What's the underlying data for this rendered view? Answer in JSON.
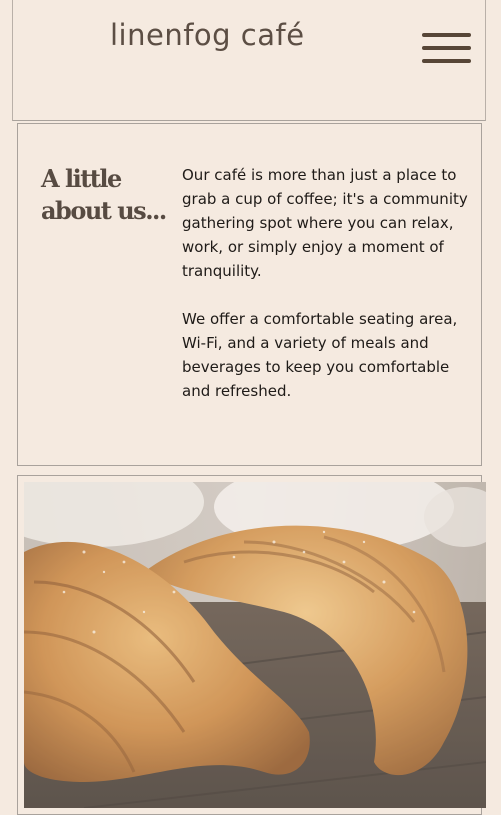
{
  "header": {
    "brand": "linenfog café",
    "menu_icon": "hamburger-menu-icon"
  },
  "about": {
    "title": "A little about us...",
    "paragraphs": [
      "Our café is more than just a place to grab a cup of coffee; it's a community gathering spot where you can relax, work, or simply enjoy a moment of tranquility.",
      "We offer a comfortable seating area, Wi-Fi, and a variety of meals and beverages to keep you comfortable and refreshed."
    ]
  },
  "colors": {
    "background": "#f5eae0",
    "brand_text": "#5c4e44",
    "menu_icon": "#574637",
    "border": "#a9a29c"
  }
}
